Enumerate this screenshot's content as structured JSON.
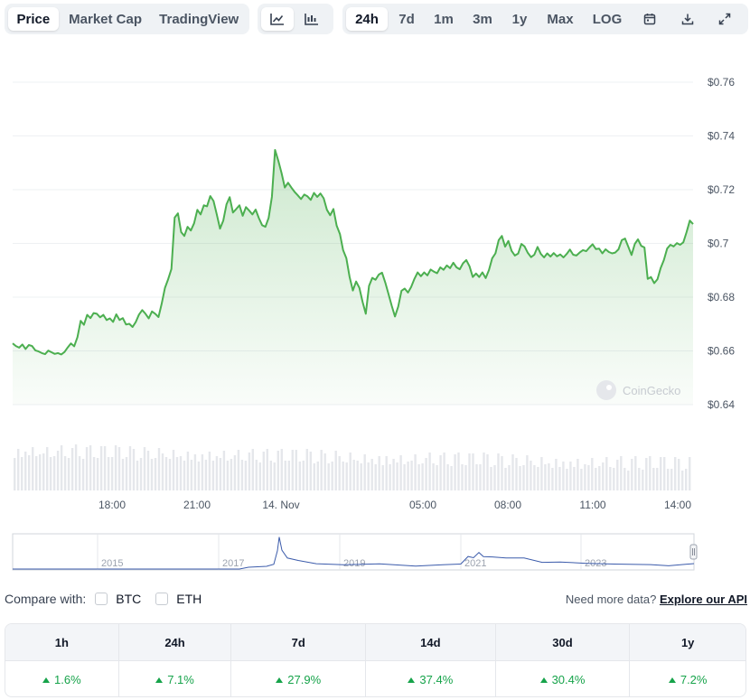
{
  "toolbar": {
    "type_tabs": [
      "Price",
      "Market Cap",
      "TradingView"
    ],
    "active_type": "Price",
    "view_icons": [
      "line-chart-icon",
      "candlestick-chart-icon"
    ],
    "range_tabs": [
      "24h",
      "7d",
      "1m",
      "3m",
      "1y",
      "Max",
      "LOG"
    ],
    "active_range": "24h",
    "tool_icons": [
      "calendar-icon",
      "download-icon",
      "expand-icon"
    ]
  },
  "watermark": "CoinGecko",
  "navigator": {
    "year_labels": [
      "2015",
      "2017",
      "2019",
      "2021",
      "2023"
    ]
  },
  "chart_data": {
    "type": "area",
    "y_ticks": [
      "$0.76",
      "$0.74",
      "$0.72",
      "$0.7",
      "$0.68",
      "$0.66",
      "$0.64"
    ],
    "x_ticks": [
      "18:00",
      "21:00",
      "14. Nov",
      "05:00",
      "08:00",
      "11:00",
      "14:00"
    ],
    "ylim": [
      0.64,
      0.76
    ],
    "line_color": "#4caf50",
    "series": [
      {
        "values": [
          0.6628,
          0.6618,
          0.6612,
          0.6624,
          0.6607,
          0.6622,
          0.6618,
          0.6602,
          0.6598,
          0.6592,
          0.6588,
          0.6601,
          0.6595,
          0.6589,
          0.6592,
          0.6587,
          0.6596,
          0.6613,
          0.6628,
          0.6617,
          0.6651,
          0.6712,
          0.6697,
          0.6734,
          0.6722,
          0.6741,
          0.6738,
          0.6725,
          0.6734,
          0.6715,
          0.6721,
          0.6708,
          0.6736,
          0.6715,
          0.6722,
          0.6698,
          0.6701,
          0.6689,
          0.6708,
          0.6735,
          0.6752,
          0.6738,
          0.6721,
          0.6747,
          0.6738,
          0.6726,
          0.6775,
          0.6834,
          0.6867,
          0.6905,
          0.7096,
          0.7112,
          0.7042,
          0.7028,
          0.7062,
          0.7048,
          0.7075,
          0.7125,
          0.7108,
          0.7142,
          0.7138,
          0.7176,
          0.7158,
          0.7108,
          0.7055,
          0.7085,
          0.7146,
          0.7172,
          0.7115,
          0.7128,
          0.7142,
          0.7103,
          0.7135,
          0.7122,
          0.7108,
          0.7126,
          0.7094,
          0.7068,
          0.7062,
          0.7095,
          0.7173,
          0.7348,
          0.7308,
          0.7262,
          0.7208,
          0.7226,
          0.7208,
          0.7192,
          0.7179,
          0.7165,
          0.7182,
          0.7175,
          0.7162,
          0.7188,
          0.7173,
          0.7186,
          0.7168,
          0.7125,
          0.7105,
          0.7128,
          0.7066,
          0.7035,
          0.6975,
          0.6945,
          0.6875,
          0.6825,
          0.6858,
          0.6835,
          0.6782,
          0.6738,
          0.6842,
          0.6872,
          0.6865,
          0.6884,
          0.6891,
          0.6854,
          0.6812,
          0.6768,
          0.6728,
          0.6765,
          0.6824,
          0.6832,
          0.6817,
          0.6838,
          0.6868,
          0.6892,
          0.6878,
          0.6892,
          0.6881,
          0.6903,
          0.6895,
          0.6889,
          0.6911,
          0.6902,
          0.6918,
          0.6908,
          0.6928,
          0.6911,
          0.6904,
          0.6926,
          0.6938,
          0.6915,
          0.6875,
          0.6888,
          0.6875,
          0.6892,
          0.6871,
          0.6901,
          0.6945,
          0.6963,
          0.7012,
          0.7028,
          0.6988,
          0.7009,
          0.6972,
          0.6955,
          0.6962,
          0.6998,
          0.6989,
          0.6965,
          0.6949,
          0.6958,
          0.6987,
          0.6961,
          0.6948,
          0.6963,
          0.6951,
          0.6964,
          0.6952,
          0.6959,
          0.6948,
          0.6961,
          0.6977,
          0.6958,
          0.6955,
          0.6966,
          0.6975,
          0.6971,
          0.6985,
          0.6997,
          0.6979,
          0.6981,
          0.6963,
          0.6978,
          0.6968,
          0.6963,
          0.6966,
          0.6978,
          0.7012,
          0.7018,
          0.6988,
          0.6957,
          0.6998,
          0.7015,
          0.6991,
          0.6985,
          0.6868,
          0.6875,
          0.6852,
          0.6867,
          0.6908,
          0.6938,
          0.6981,
          0.6995,
          0.6989,
          0.7001,
          0.6995,
          0.7004,
          0.7042,
          0.7085,
          0.7072
        ]
      }
    ]
  },
  "compare": {
    "label": "Compare with:",
    "options": [
      "BTC",
      "ETH"
    ],
    "api_text": "Need more data?",
    "api_link": "Explore our API"
  },
  "performance": {
    "headers": [
      "1h",
      "24h",
      "7d",
      "14d",
      "30d",
      "1y"
    ],
    "values": [
      "1.6%",
      "7.1%",
      "27.9%",
      "37.4%",
      "30.4%",
      "7.2%"
    ],
    "positive_color": "#16a34a"
  }
}
